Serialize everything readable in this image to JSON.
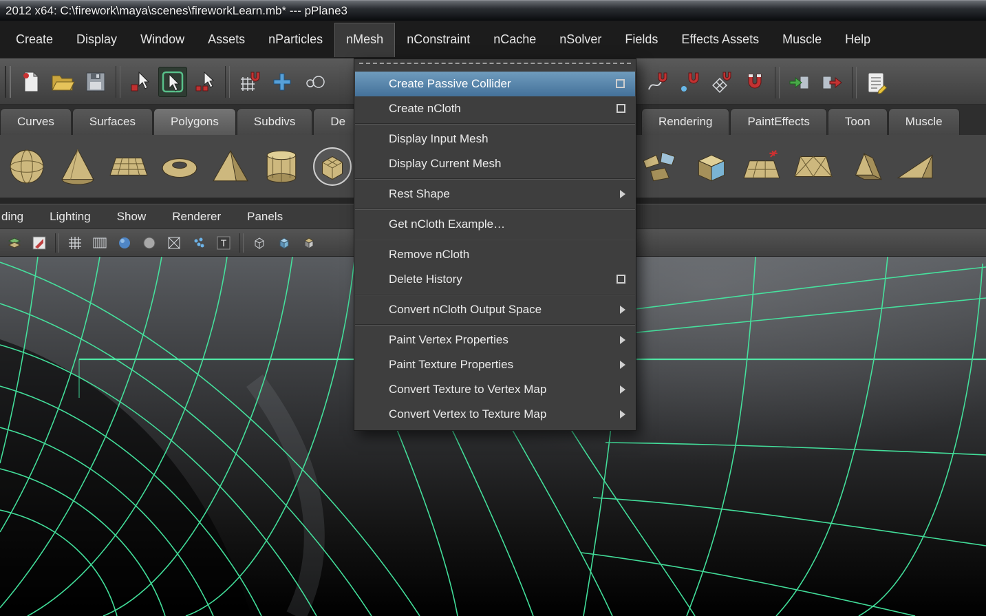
{
  "colors": {
    "menu_highlight": "#4d7ba2",
    "wireframe_green": "#45e8a1",
    "shelf_icon_tan": "#cdb87e",
    "ui_background": "#3e3e3e"
  },
  "titlebar": {
    "title": "2012 x64: C:\\firework\\maya\\scenes\\fireworkLearn.mb*   ---   pPlane3"
  },
  "menubar": {
    "items": [
      {
        "label": "Create"
      },
      {
        "label": "Display"
      },
      {
        "label": "Window"
      },
      {
        "label": "Assets"
      },
      {
        "label": "nParticles"
      },
      {
        "label": "nMesh",
        "active": true
      },
      {
        "label": "nConstraint"
      },
      {
        "label": "nCache"
      },
      {
        "label": "nSolver"
      },
      {
        "label": "Fields"
      },
      {
        "label": "Effects Assets"
      },
      {
        "label": "Muscle"
      },
      {
        "label": "Help"
      }
    ]
  },
  "toolbar": {
    "icons": [
      "new-scene-icon",
      "open-scene-icon",
      "save-scene-icon",
      "select-by-hierarchy-icon",
      "select-by-object-type-icon",
      "select-by-component-icon",
      "snap-to-grids-icon",
      "crosshair-icon",
      "paint-select-icon",
      "snap-to-curves-icon",
      "snap-to-points-icon",
      "snap-to-view-planes-icon",
      "make-object-live-icon",
      "input-connections-icon",
      "output-connections-icon",
      "construction-history-icon"
    ]
  },
  "shelf_tabs": {
    "left": [
      {
        "label": "Curves"
      },
      {
        "label": "Surfaces"
      },
      {
        "label": "Polygons",
        "active": true
      },
      {
        "label": "Subdivs"
      },
      {
        "label": "De"
      }
    ],
    "right": [
      {
        "label": "Rendering"
      },
      {
        "label": "PaintEffects"
      },
      {
        "label": "Toon"
      },
      {
        "label": "Muscle"
      }
    ]
  },
  "shelf": {
    "icons": [
      "poly-sphere-icon",
      "poly-cone-icon",
      "poly-plane-icon",
      "poly-torus-icon",
      "poly-pyramid-icon",
      "poly-pipe-icon",
      "smooth-mesh-icon",
      "sculpt-geometry-icon",
      "poly-shatter-icon",
      "poly-cube-icon",
      "poly-poke-icon",
      "poly-triangulate-icon",
      "poly-prism-icon",
      "poly-wedge-icon"
    ]
  },
  "panel_menubar": {
    "items": [
      {
        "label": "ding"
      },
      {
        "label": "Lighting"
      },
      {
        "label": "Show"
      },
      {
        "label": "Renderer"
      },
      {
        "label": "Panels"
      }
    ]
  },
  "panel_toolbar": {
    "icons": [
      "layers-icon",
      "paint-icon",
      "grid-icon",
      "film-gate-icon",
      "shaded-sphere-icon",
      "flat-sphere-icon",
      "xray-icon",
      "particles-icon",
      "texture-letter-icon",
      "wireframe-cube-icon",
      "shaded-cube-icon",
      "textured-cube-icon"
    ]
  },
  "nmesh_menu": {
    "items": [
      {
        "label": "Create Passive Collider",
        "option_box": true,
        "highlighted": true
      },
      {
        "label": "Create nCloth",
        "option_box": true,
        "sep_after": true
      },
      {
        "label": "Display Input Mesh"
      },
      {
        "label": "Display Current Mesh",
        "sep_after": true
      },
      {
        "label": "Rest Shape",
        "submenu": true,
        "sep_after": true
      },
      {
        "label": "Get nCloth Example…",
        "sep_after": true
      },
      {
        "label": "Remove nCloth"
      },
      {
        "label": "Delete History",
        "option_box": true,
        "sep_after": true
      },
      {
        "label": "Convert nCloth Output Space",
        "submenu": true,
        "sep_after": true
      },
      {
        "label": "Paint Vertex Properties",
        "submenu": true
      },
      {
        "label": "Paint Texture Properties",
        "submenu": true
      },
      {
        "label": "Convert Texture to Vertex Map",
        "submenu": true
      },
      {
        "label": "Convert Vertex to Texture Map",
        "submenu": true
      }
    ]
  }
}
